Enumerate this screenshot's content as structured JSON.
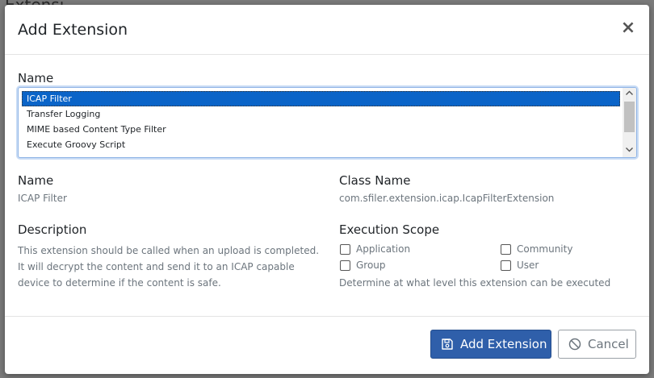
{
  "background": {
    "title": "Extensi"
  },
  "modal": {
    "title": "Add Extension",
    "close_glyph": "×"
  },
  "name_select": {
    "label": "Name",
    "options": [
      "ICAP Filter",
      "Transfer Logging",
      "MIME based Content Type Filter",
      "Execute Groovy Script"
    ],
    "selected_index": 0
  },
  "details": {
    "name_label": "Name",
    "name_value": "ICAP Filter",
    "class_label": "Class Name",
    "class_value": "com.sfiler.extension.icap.IcapFilterExtension",
    "description_label": "Description",
    "description_value": "This extension should be called when an upload is completed. It will decrypt the content and send it to an ICAP capable device to determine if the content is safe.",
    "scope_label": "Execution Scope",
    "scope_options": [
      "Application",
      "Community",
      "Group",
      "User"
    ],
    "scope_help": "Determine at what level this extension can be executed"
  },
  "footer": {
    "add_label": "Add Extension",
    "cancel_label": "Cancel"
  },
  "colors": {
    "primary": "#2f5faa",
    "selected_option": "#0a64c8"
  }
}
